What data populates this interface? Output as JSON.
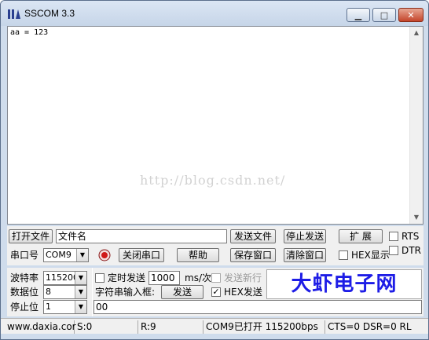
{
  "window": {
    "title": "SSCOM 3.3"
  },
  "receive": {
    "text": "aa = 123",
    "watermark": "http://blog.csdn.net/"
  },
  "file_row": {
    "open_file_label": "打开文件",
    "filename_value": "文件名",
    "send_file_label": "发送文件",
    "stop_send_label": "停止发送",
    "expand_label": "扩 展",
    "rts_label": "RTS"
  },
  "port_row": {
    "port_label": "串口号",
    "port_value": "COM9",
    "close_port_label": "关闭串口",
    "help_label": "帮助",
    "save_window_label": "保存窗口",
    "clear_window_label": "清除窗口",
    "hex_display_label": "HEX显示",
    "dtr_label": "DTR"
  },
  "settings": {
    "baud_label": "波特率",
    "baud_value": "115200",
    "databits_label": "数据位",
    "databits_value": "8",
    "stopbits_label": "停止位",
    "stopbits_value": "1"
  },
  "send": {
    "timed_send_label": "定时发送",
    "interval_value": "1000",
    "interval_unit": "ms/次",
    "send_newline_label": "发送新行",
    "input_label": "字符串输入框:",
    "send_button_label": "发送",
    "hex_send_label": "HEX发送",
    "input_value": "00",
    "timed_send_checked": false,
    "send_newline_checked": false,
    "hex_display_checked": false,
    "hex_send_checked": true,
    "rts_checked": false,
    "dtr_checked": false
  },
  "brand": {
    "text": "大虾电子网"
  },
  "status": {
    "website": "www.daxia.cor",
    "sent": "S:0",
    "received": "R:9",
    "port_status": "COM9已打开  115200bps",
    "lines": "CTS=0 DSR=0 RL"
  },
  "colors": {
    "brand": "#1d1ce6",
    "close_button": "#c4442a",
    "titlebar": "#cfdcec"
  }
}
